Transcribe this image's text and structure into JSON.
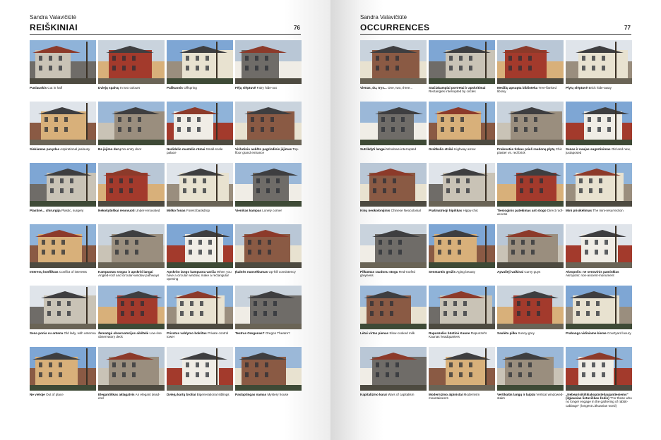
{
  "left_page": {
    "author": "Sandra Valavičiūtė",
    "section_title": "REIŠKINIAI",
    "page_number": "76",
    "tiles": [
      {
        "lt": "Puslauskis",
        "en": "Cut in half"
      },
      {
        "lt": "Dviejų spalvų",
        "en": "In two colours"
      },
      {
        "lt": "Palikuonis",
        "en": "Offspring"
      },
      {
        "lt": "Fėjų slėptuvė",
        "en": "Fairy hide-out"
      },
      {
        "lt": "Siekiamas pavydas",
        "en": "Aspirational jealousy"
      },
      {
        "lt": "Be įėjimo durų",
        "en": "No-entry door"
      },
      {
        "lt": "Nedidelio mastelio rūmai",
        "en": "Small-scale palace"
      },
      {
        "lt": "Viršutinio aukšto pagrindinis įėjimas",
        "en": "Top-floor grand entrance"
      },
      {
        "lt": "Plastinė... chirurgija",
        "en": "Plastic, surgery"
      },
      {
        "lt": "Nekokybiškai renovuoti",
        "en": "Under-renovated"
      },
      {
        "lt": "Miško fonas",
        "en": "Forest backdrop"
      },
      {
        "lt": "Vienišas kampas",
        "en": "Lonely corner"
      },
      {
        "lt": "Interesų konfliktas",
        "en": "Conflict of interests"
      },
      {
        "lt": "Kampuotas stogas ir apskriti langai",
        "en": "Angled-roof and circular-window pathways"
      },
      {
        "lt": "Apskrito lango kampuota varčia",
        "en": "When you have a circular window, make a rectangular opening"
      },
      {
        "lt": "Įkalnės nuoseklumas",
        "en": "Up-hill consistency"
      },
      {
        "lt": "Sena ponia su antena",
        "en": "Old lady, with antenna"
      },
      {
        "lt": "Žemaūgė observatorijos aikštelė",
        "en": "Low-rise observatory deck"
      },
      {
        "lt": "Privatus valdymo bokštas",
        "en": "Private control tower"
      },
      {
        "lt": "Teatras Oregonas?",
        "en": "Oregon Theatre?"
      },
      {
        "lt": "Ne vietoje",
        "en": "Out of place"
      },
      {
        "lt": "Elegantiškas aklagatvis",
        "en": "An elegant dead-end"
      },
      {
        "lt": "Dviejų kartų broliai",
        "en": "Bigenerational siblings"
      },
      {
        "lt": "Paslaptingas namas",
        "en": "Mystery house"
      }
    ]
  },
  "right_page": {
    "author": "Sandra Valavičiūtė",
    "section_title": "OCCURRENCES",
    "page_number": "77",
    "tiles": [
      {
        "lt": "Vienas, du, trys...",
        "en": "One, two, three..."
      },
      {
        "lt": "Stačiakampiai portretai ir apskritimai",
        "en": "Rectangles interrupted by circles"
      },
      {
        "lt": "Medžių apsupta biblioteka",
        "en": "Tree-flanked library"
      },
      {
        "lt": "Plytų slėptuvė",
        "en": "Brick hide-away"
      },
      {
        "lt": "Sutrikdyti langai",
        "en": "Windows-interrupted"
      },
      {
        "lt": "Greitkelio strėlė",
        "en": "Highway arrow"
      },
      {
        "lt": "Pralenatės tinkas prieš raudoną plytą",
        "en": "Chic plaster vs. red brick"
      },
      {
        "lt": "Senas ir naujas sugretinimas",
        "en": "Old and new, juxtaposed"
      },
      {
        "lt": "Kinų neokolonijinis",
        "en": "Chinese Neocolonial"
      },
      {
        "lt": "Prašmatnioji hipiškas",
        "en": "Hippy-chic"
      },
      {
        "lt": "Tiesioginis patekimas ant stogo",
        "en": "Direct roof-access"
      },
      {
        "lt": "Mini prisikėlimas",
        "en": "The mini-resurrection"
      },
      {
        "lt": "Pilkumas raudonu stogu",
        "en": "Red-roofed greyness"
      },
      {
        "lt": "Senstantis grožis",
        "en": "Aging beauty"
      },
      {
        "lt": "Apvalieji vaikinai",
        "en": "Curvy guys"
      },
      {
        "lt": "Akropolis: ne senovinis paminklas",
        "en": "Akropolis: non-ancient-monument"
      },
      {
        "lt": "Lėtai virtas pienas",
        "en": "Slow-cooked milk"
      },
      {
        "lt": "Rapunzelės būstinė Kaune",
        "en": "Rapunzel's Kaunas headquarters"
      },
      {
        "lt": "Saulėta pilka",
        "en": "Sunny-grey"
      },
      {
        "lt": "Prabanga vidiniame kieme",
        "en": "Courtyard luxury"
      },
      {
        "lt": "Kapitalizmo karai",
        "en": "Wars of capitalism"
      },
      {
        "lt": "Modernizmo alpinistai",
        "en": "Modernism mountaineers"
      },
      {
        "lt": "Vertikalūs langų ir laiptai",
        "en": "Vertical windowed-stairs"
      },
      {
        "lt": "„Nebeprisikiškiakopūsteliaujantiesiems\" (ilgiausias lietuviškas žodis)",
        "en": "\"For those who no longer engage in the gathering of rabbit-cabbage\" (longest Lithuanian word)"
      }
    ]
  },
  "palette": {
    "sky": [
      "#8fb3d9",
      "#c9d3dd",
      "#7ea6d4",
      "#b9c7d6",
      "#dfe4ea",
      "#9bb8d8"
    ],
    "walls": [
      "#c9c3b6",
      "#a33a2c",
      "#e8e2d0",
      "#6f6c68",
      "#d8b07a",
      "#9a8e7e",
      "#f0ede6",
      "#8a5a44"
    ],
    "ground": [
      "#4d4a40",
      "#6a6456",
      "#3e4a36"
    ]
  }
}
